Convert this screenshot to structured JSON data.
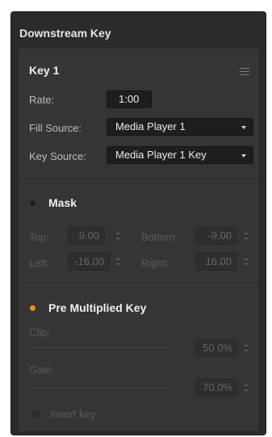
{
  "panel": {
    "title": "Downstream Key"
  },
  "key": {
    "title": "Key 1",
    "menu_icon": "hamburger-menu-icon",
    "rate_label": "Rate:",
    "rate_value": "1:00",
    "fill_source_label": "Fill Source:",
    "fill_source_value": "Media Player 1",
    "key_source_label": "Key Source:",
    "key_source_value": "Media Player 1 Key"
  },
  "mask": {
    "label": "Mask",
    "enabled": false,
    "indicator_color": "#1f1f1f",
    "top_label": "Top:",
    "top_value": "9.00",
    "bottom_label": "Bottom:",
    "bottom_value": "-9.00",
    "left_label": "Left:",
    "left_value": "-16.00",
    "right_label": "Right:",
    "right_value": "16.00"
  },
  "premultiplied": {
    "label": "Pre Multiplied Key",
    "enabled": true,
    "indicator_color": "#f28c28",
    "clip_label": "Clip:",
    "clip_value": "50.0%",
    "gain_label": "Gain:",
    "gain_value": "70.0%",
    "invert_label": "Invert key",
    "invert_checked": false
  },
  "colors": {
    "panel_bg": "#2b2b2b",
    "section_bg": "#353535",
    "field_bg": "#1e1e1e",
    "accent": "#f28c28"
  }
}
